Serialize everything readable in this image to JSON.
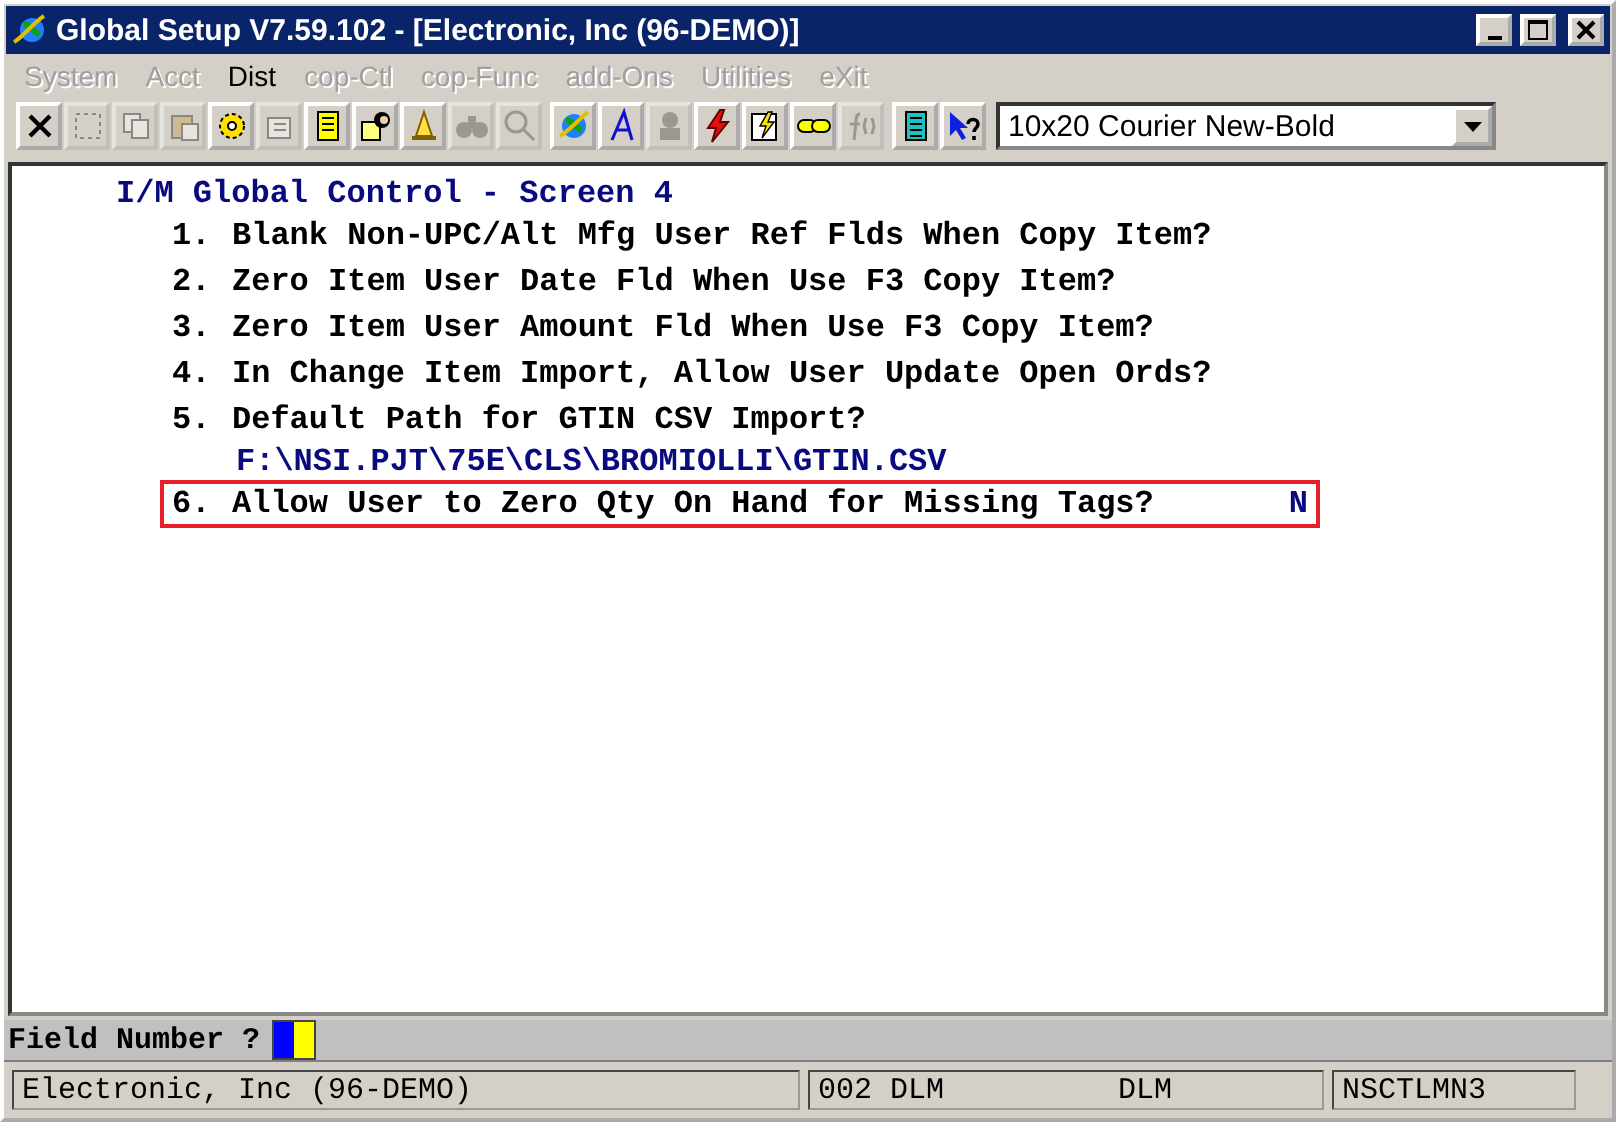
{
  "window": {
    "title": "Global Setup V7.59.102 - [Electronic, Inc (96-DEMO)]"
  },
  "menu": [
    {
      "label": "System",
      "disabled": true
    },
    {
      "label": "Acct",
      "disabled": true
    },
    {
      "label": "Dist",
      "disabled": false
    },
    {
      "label": "cop-Ctl",
      "disabled": true
    },
    {
      "label": "cop-Func",
      "disabled": true
    },
    {
      "label": "add-Ons",
      "disabled": true
    },
    {
      "label": "Utilities",
      "disabled": true
    },
    {
      "label": "eXit",
      "disabled": true
    }
  ],
  "toolbar": [
    {
      "disabled": false
    },
    {
      "disabled": true
    },
    {
      "disabled": true
    },
    {
      "disabled": true
    },
    {
      "disabled": false
    },
    {
      "disabled": true
    },
    {
      "disabled": false
    },
    {
      "disabled": false
    },
    {
      "disabled": false
    },
    {
      "disabled": true
    },
    {
      "disabled": true
    },
    {
      "disabled": false
    },
    {
      "disabled": false
    },
    {
      "disabled": true
    },
    {
      "disabled": false
    },
    {
      "disabled": false
    },
    {
      "disabled": false
    },
    {
      "disabled": true
    },
    {
      "disabled": false
    },
    {
      "disabled": false
    }
  ],
  "font_select": {
    "value": "10x20 Courier New-Bold"
  },
  "screen": {
    "title": "I/M Global Control - Screen 4",
    "fields": [
      {
        "number": "1.",
        "question": "Blank Non-UPC/Alt Mfg User Ref Flds When Copy Item?",
        "selected": false
      },
      {
        "number": "2.",
        "question": "Zero Item User Date Fld When Use F3 Copy Item?",
        "selected": false
      },
      {
        "number": "3.",
        "question": "Zero Item User Amount Fld When Use F3 Copy Item?",
        "selected": false
      },
      {
        "number": "4.",
        "question": "In Change Item Import, Allow User Update Open Ords?",
        "selected": false
      },
      {
        "number": "5.",
        "question": "Default Path for GTIN CSV Import?",
        "value": "F:\\NSI.PJT\\75E\\CLS\\BROMIOLLI\\GTIN.CSV",
        "selected": false
      },
      {
        "number": "6.",
        "question": "Allow User to Zero Qty On Hand for Missing Tags?",
        "value": "N",
        "selected": true
      }
    ]
  },
  "prompt": {
    "label": "Field Number ?"
  },
  "status_bar": [
    "Electronic, Inc (96-DEMO)",
    "002 DLM",
    "DLM",
    "NSCTLMN3"
  ]
}
